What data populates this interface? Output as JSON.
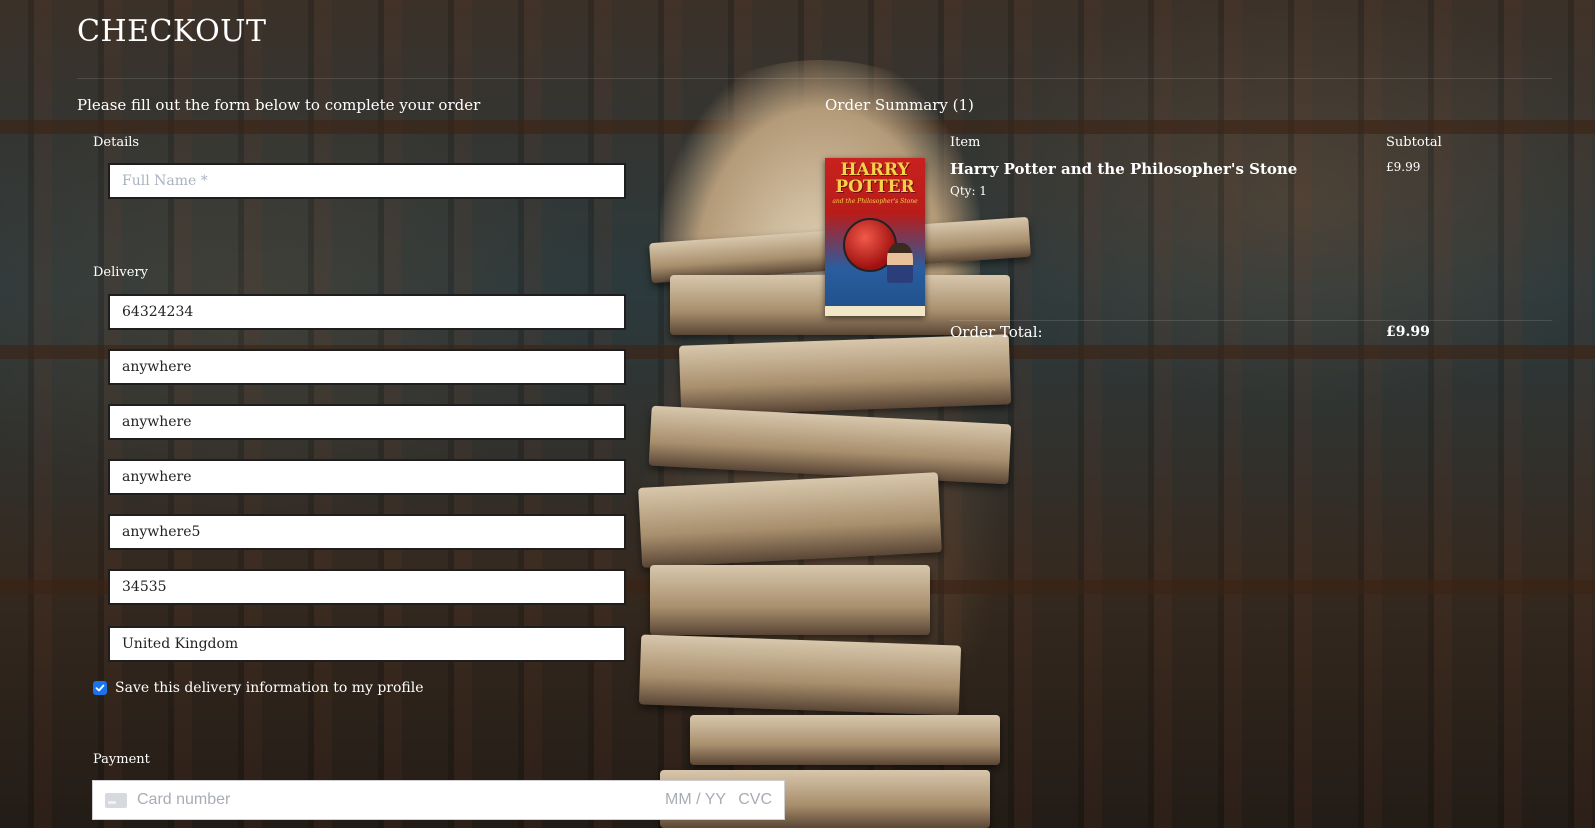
{
  "header": {
    "title": "CHECKOUT",
    "intro": "Please fill out the form below to complete your order"
  },
  "details": {
    "label": "Details",
    "full_name_placeholder": "Full Name *",
    "full_name_value": ""
  },
  "delivery": {
    "label": "Delivery",
    "fields": [
      "64324234",
      "anywhere",
      "anywhere",
      "anywhere",
      "anywhere5",
      "34535",
      "United Kingdom"
    ],
    "save_label": "Save this delivery information to my profile",
    "save_checked": true
  },
  "payment": {
    "label": "Payment",
    "card_placeholder": "Card number",
    "expiry_placeholder": "MM / YY",
    "cvc_placeholder": "CVC"
  },
  "summary": {
    "title": "Order Summary (1)",
    "col_item": "Item",
    "col_subtotal": "Subtotal",
    "items": [
      {
        "name": "Harry Potter and the Philosopher's Stone",
        "qty": "Qty: 1",
        "subtotal": "£9.99",
        "cover_title": "HARRY POTTER",
        "cover_subtitle": "and the Philosopher's Stone"
      }
    ],
    "total_label": "Order Total:",
    "total_value": "£9.99"
  },
  "colors": {
    "checkbox_accent": "#1a73e8",
    "field_bg": "#ffffff",
    "text": "#ffffff"
  }
}
